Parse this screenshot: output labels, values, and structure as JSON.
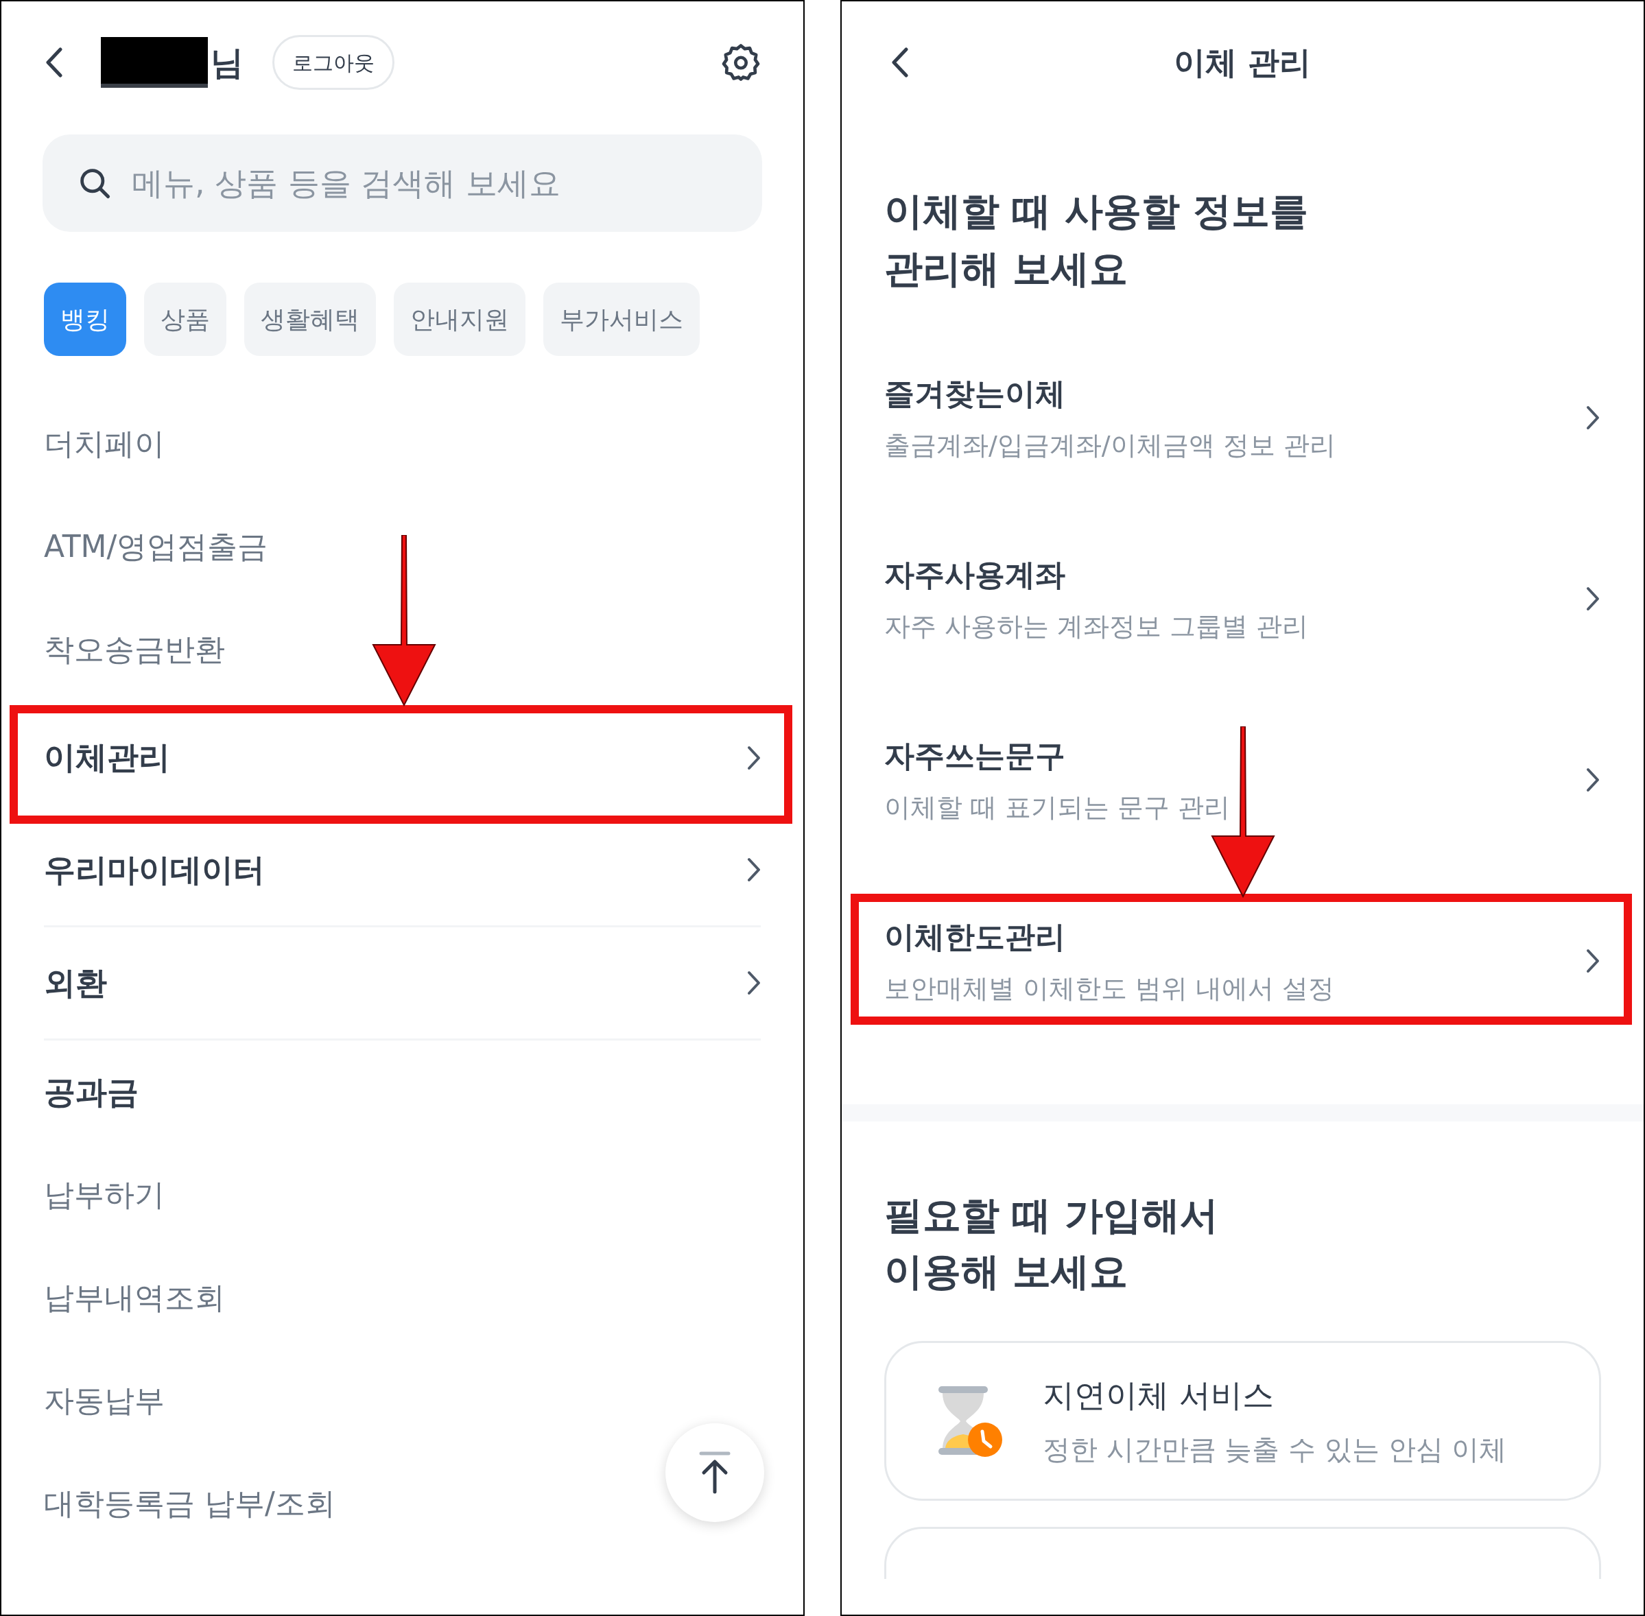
{
  "menu_screen": {
    "user_suffix": "님",
    "logout": "로그아웃",
    "search": {
      "placeholder": "메뉴, 상품 등을 검색해 보세요"
    },
    "tabs": [
      {
        "label": "뱅킹",
        "selected": true
      },
      {
        "label": "상품",
        "selected": false
      },
      {
        "label": "생활혜택",
        "selected": false
      },
      {
        "label": "안내지원",
        "selected": false
      },
      {
        "label": "부가서비스",
        "selected": false
      }
    ],
    "items": [
      {
        "kind": "link",
        "label": "더치페이",
        "highlighted": false,
        "divider": false
      },
      {
        "kind": "link",
        "label": "ATM/영업점출금",
        "highlighted": false,
        "divider": false
      },
      {
        "kind": "link",
        "label": "착오송금반환",
        "highlighted": false,
        "divider": false
      },
      {
        "kind": "nav",
        "label": "이체관리",
        "highlighted": true,
        "divider": false
      },
      {
        "kind": "nav",
        "label": "우리마이데이터",
        "highlighted": false,
        "divider": true
      },
      {
        "kind": "nav",
        "label": "외환",
        "highlighted": false,
        "divider": true
      },
      {
        "kind": "heading",
        "label": "공과금",
        "highlighted": false,
        "divider": false
      },
      {
        "kind": "link",
        "label": "납부하기",
        "highlighted": false,
        "divider": false
      },
      {
        "kind": "link",
        "label": "납부내역조회",
        "highlighted": false,
        "divider": false
      },
      {
        "kind": "link",
        "label": "자동납부",
        "highlighted": false,
        "divider": false
      },
      {
        "kind": "link",
        "label": "대학등록금 납부/조회",
        "highlighted": false,
        "divider": false
      }
    ]
  },
  "transfer_screen": {
    "title": "이체 관리",
    "heading_lines": [
      "이체할 때 사용할 정보를",
      "관리해 보세요"
    ],
    "items": [
      {
        "title": "즐겨찾는이체",
        "description": "출금계좌/입금계좌/이체금액 정보 관리",
        "highlighted": false
      },
      {
        "title": "자주사용계좌",
        "description": "자주 사용하는 계좌정보 그룹별 관리",
        "highlighted": false
      },
      {
        "title": "자주쓰는문구",
        "description": "이체할 때 표기되는 문구 관리",
        "highlighted": false
      },
      {
        "title": "이체한도관리",
        "description": "보안매체별 이체한도 범위 내에서 설정",
        "highlighted": true
      }
    ],
    "section_heading_lines": [
      "필요할 때 가입해서",
      "이용해 보세요"
    ],
    "services": [
      {
        "title": "지연이체 서비스",
        "description": "정한 시간만큼 늦출 수 있는 안심 이체"
      }
    ]
  }
}
